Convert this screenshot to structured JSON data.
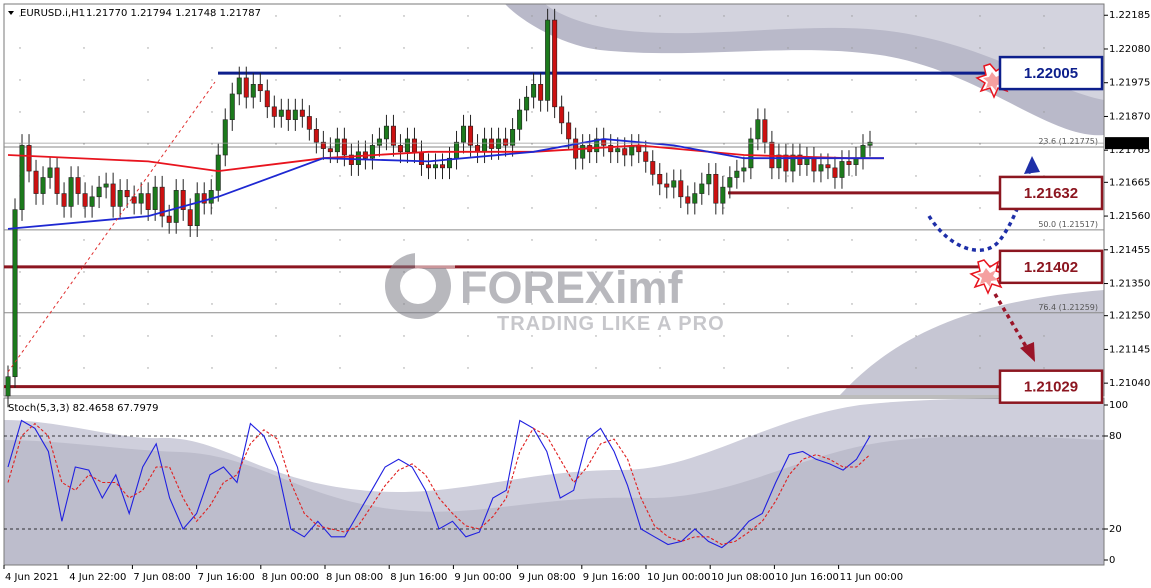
{
  "header": {
    "symbol": "EURUSD.i,H1",
    "ohlc": "1.21770 1.21794 1.21748 1.21787"
  },
  "watermark": {
    "brand": "FOREXimf",
    "tagline": "TRADING LIKE A PRO"
  },
  "colors": {
    "bull": "#1c7a1c",
    "bear": "#cc1111",
    "ma_red": "#e8141e",
    "ma_blue": "#1e28d2",
    "resistance": "#0d1f8c",
    "support": "#8c1620",
    "stoch_main": "#2020e0",
    "stoch_signal": "#e02020"
  },
  "chart_data": [
    {
      "type": "candlestick",
      "timeframe": "H1",
      "ylim": [
        1.21,
        1.2222
      ],
      "y_ticks": [
        "1.22185",
        "1.22080",
        "1.21975",
        "1.21870",
        "1.21765",
        "1.21665",
        "1.21560",
        "1.21455",
        "1.21350",
        "1.21250",
        "1.21145",
        "1.21040"
      ],
      "current_price": "1.21787",
      "x_ticks": [
        "4 Jun 2021",
        "4 Jun 22:00",
        "7 Jun 08:00",
        "7 Jun 16:00",
        "8 Jun 00:00",
        "8 Jun 08:00",
        "8 Jun 16:00",
        "9 Jun 00:00",
        "9 Jun 08:00",
        "9 Jun 16:00",
        "10 Jun 00:00",
        "10 Jun 08:00",
        "10 Jun 16:00",
        "11 Jun 00:00"
      ],
      "closes": [
        1.2106,
        1.2158,
        1.2178,
        1.217,
        1.2163,
        1.2168,
        1.2171,
        1.2163,
        1.2159,
        1.2168,
        1.2163,
        1.2159,
        1.2162,
        1.2165,
        1.2166,
        1.2159,
        1.2164,
        1.2162,
        1.216,
        1.2163,
        1.2158,
        1.2165,
        1.2156,
        1.2154,
        1.2164,
        1.2158,
        1.2153,
        1.2163,
        1.216,
        1.2164,
        1.2175,
        1.2186,
        1.2194,
        1.2199,
        1.2193,
        1.2197,
        1.2195,
        1.219,
        1.2187,
        1.2189,
        1.2186,
        1.2189,
        1.2187,
        1.2183,
        1.2179,
        1.2177,
        1.2176,
        1.218,
        1.2175,
        1.2172,
        1.2176,
        1.2174,
        1.2178,
        1.218,
        1.2184,
        1.2178,
        1.2176,
        1.218,
        1.2176,
        1.2172,
        1.2171,
        1.2172,
        1.2171,
        1.2174,
        1.2179,
        1.2184,
        1.2178,
        1.2176,
        1.218,
        1.2177,
        1.218,
        1.2178,
        1.2183,
        1.2189,
        1.2193,
        1.2197,
        1.2192,
        1.2217,
        1.219,
        1.2185,
        1.218,
        1.2174,
        1.2178,
        1.2176,
        1.218,
        1.2178,
        1.2176,
        1.2177,
        1.2175,
        1.2178,
        1.2176,
        1.2173,
        1.2169,
        1.2166,
        1.2165,
        1.2167,
        1.2162,
        1.216,
        1.2163,
        1.2166,
        1.2169,
        1.216,
        1.2165,
        1.2168,
        1.217,
        1.2171,
        1.218,
        1.2186,
        1.2179,
        1.2171,
        1.2175,
        1.217,
        1.2175,
        1.2172,
        1.2174,
        1.217,
        1.2172,
        1.2171,
        1.2168,
        1.2173,
        1.2172,
        1.2174,
        1.2178,
        1.2179
      ],
      "moving_averages": [
        {
          "color": "#e8141e",
          "points": [
            [
              0,
              1.2175
            ],
            [
              20,
              1.2173
            ],
            [
              30,
              1.217
            ],
            [
              45,
              1.2174
            ],
            [
              60,
              1.2176
            ],
            [
              75,
              1.2176
            ],
            [
              90,
              1.2178
            ],
            [
              105,
              1.2175
            ],
            [
              120,
              1.2174
            ],
            [
              125,
              1.2174
            ]
          ]
        },
        {
          "color": "#1e28d2",
          "points": [
            [
              0,
              1.2152
            ],
            [
              20,
              1.2156
            ],
            [
              30,
              1.2162
            ],
            [
              45,
              1.2174
            ],
            [
              60,
              1.2173
            ],
            [
              75,
              1.2176
            ],
            [
              85,
              1.218
            ],
            [
              95,
              1.2178
            ],
            [
              105,
              1.2174
            ],
            [
              125,
              1.2174
            ]
          ]
        }
      ],
      "levels": [
        {
          "label": "1.22005",
          "value": 1.22005,
          "kind": "resistance"
        },
        {
          "label": "1.21632",
          "value": 1.21632,
          "kind": "support"
        },
        {
          "label": "1.21402",
          "value": 1.21402,
          "kind": "support"
        },
        {
          "label": "1.21029",
          "value": 1.21029,
          "kind": "support"
        }
      ],
      "fibonacci": [
        {
          "label": "23.6 (1.21775)",
          "value": 1.21775
        },
        {
          "label": "50.0 (1.21517)",
          "value": 1.21517
        },
        {
          "label": "76.4 (1.21259)",
          "value": 1.21259
        }
      ]
    },
    {
      "type": "line",
      "title": "Stoch(5,3,3) 82.4658 67.7979",
      "ylim": [
        0,
        100
      ],
      "y_ticks": [
        "100",
        "80",
        "20",
        "0"
      ],
      "levels": [
        80,
        20
      ],
      "series": [
        {
          "name": "main",
          "color": "#2020e0",
          "values": [
            60,
            90,
            85,
            70,
            25,
            60,
            58,
            40,
            55,
            30,
            60,
            75,
            40,
            20,
            30,
            55,
            60,
            50,
            88,
            80,
            60,
            20,
            15,
            25,
            15,
            15,
            30,
            45,
            60,
            65,
            60,
            45,
            20,
            25,
            15,
            18,
            40,
            45,
            90,
            85,
            70,
            40,
            45,
            78,
            85,
            70,
            48,
            20,
            15,
            10,
            12,
            20,
            12,
            8,
            15,
            25,
            30,
            50,
            68,
            70,
            65,
            62,
            58,
            65,
            80
          ]
        },
        {
          "name": "signal",
          "color": "#e02020",
          "values": [
            50,
            80,
            88,
            80,
            50,
            45,
            55,
            50,
            50,
            40,
            45,
            60,
            60,
            40,
            25,
            35,
            50,
            55,
            75,
            84,
            78,
            50,
            30,
            22,
            20,
            18,
            22,
            35,
            48,
            58,
            62,
            55,
            40,
            30,
            22,
            20,
            28,
            40,
            70,
            85,
            80,
            65,
            50,
            60,
            75,
            78,
            65,
            40,
            22,
            15,
            12,
            15,
            15,
            10,
            12,
            18,
            25,
            38,
            55,
            65,
            68,
            65,
            60,
            60,
            68
          ]
        }
      ]
    }
  ]
}
